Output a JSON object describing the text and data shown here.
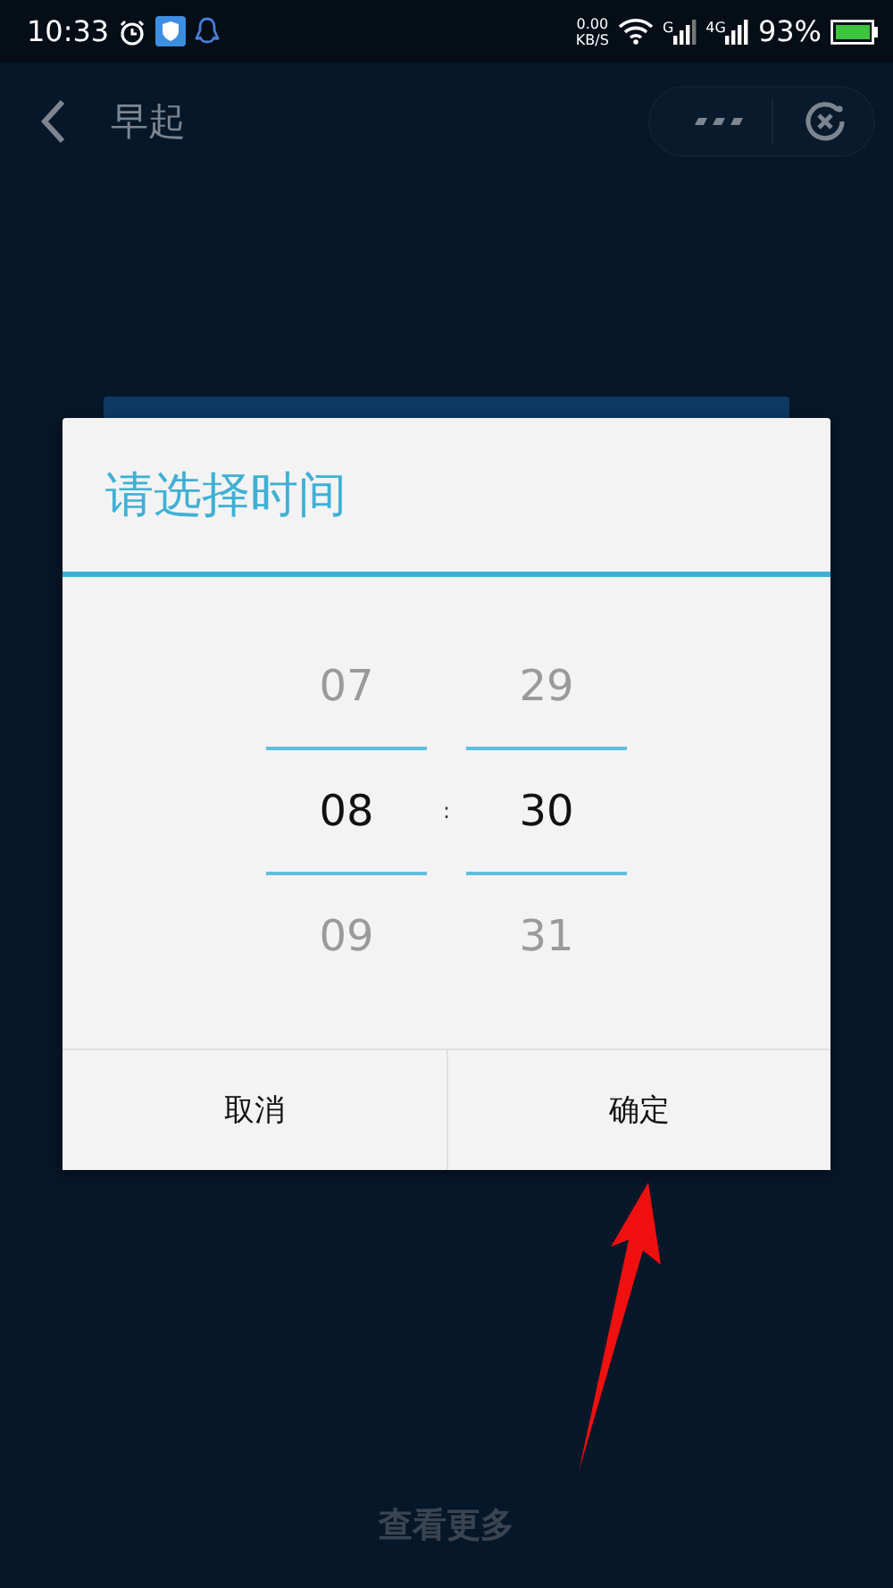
{
  "status_bar": {
    "time": "10:33",
    "net_speed": "0.00",
    "net_unit": "KB/S",
    "sim_1": "G",
    "sim_2": "4G",
    "battery": "93%"
  },
  "header": {
    "title": "早起"
  },
  "dialog": {
    "title": "请选择时间",
    "separator": ":",
    "columns": [
      {
        "items": [
          {
            "text": "07",
            "selected": false
          },
          {
            "text": "08",
            "selected": true
          },
          {
            "text": "09",
            "selected": false
          }
        ]
      },
      {
        "items": [
          {
            "text": "29",
            "selected": false
          },
          {
            "text": "30",
            "selected": true
          },
          {
            "text": "31",
            "selected": false
          }
        ]
      }
    ],
    "buttons": [
      {
        "label": "取消"
      },
      {
        "label": "确定"
      }
    ]
  },
  "footer": {
    "link": "查看更多"
  }
}
